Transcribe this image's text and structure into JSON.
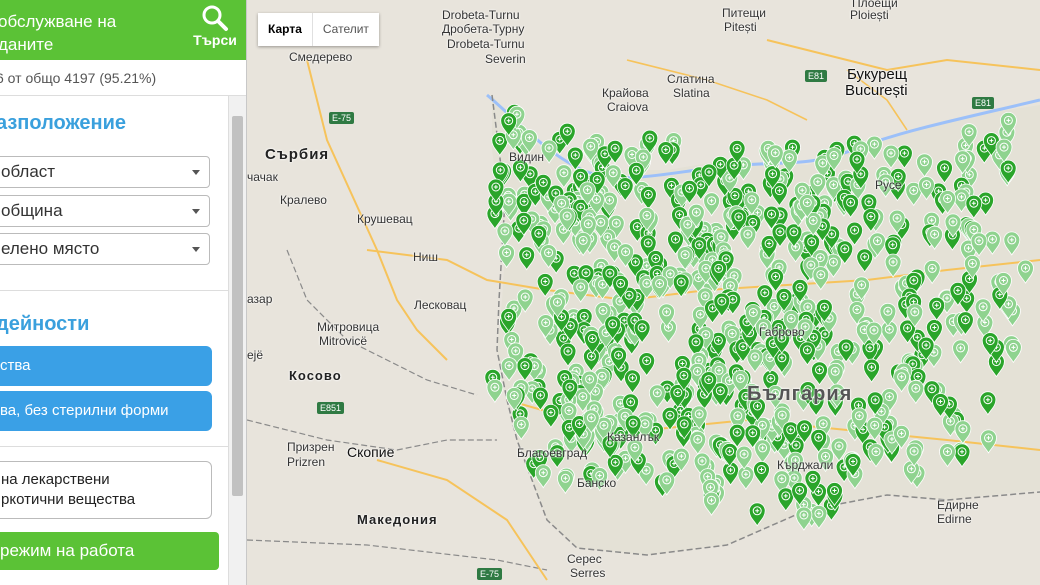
{
  "sidebar": {
    "title_line1": "обслужване на",
    "title_line2": "даните",
    "search_label": "Търси",
    "stats": "6 от общо 4197 (95.21%)",
    "location_title": "азположение",
    "selects": [
      {
        "value": " област"
      },
      {
        "value": " община"
      },
      {
        "value": "елено място"
      }
    ],
    "activities_title": "дейности",
    "activity_buttons": [
      {
        "label": "ства"
      },
      {
        "label": "ва, без стерилни форми"
      }
    ],
    "checkbox_line1": "на лекарствени",
    "checkbox_line2": "ркотични вещества",
    "hours_button": "режим на работа"
  },
  "map": {
    "type_buttons": {
      "map": "Карта",
      "satellite": "Сателит"
    },
    "labels": {
      "smederevo": "Смедерево",
      "drobeta_top": "Drobeta-Turnu",
      "drobeta_cyr": "Дробета-Турну",
      "drobeta_lat": "Drobeta-Turnu",
      "severin": "Severin",
      "severin_cyr": "Северин",
      "pitesti_cyr": "Питещи",
      "pitesti": "Pitești",
      "ploiesti_cyr": "Плоещи",
      "ploiesti": "Ploiești",
      "slatina_cyr": "Слатина",
      "slatina": "Slatina",
      "craiova_cyr": "Крайова",
      "craiova": "Craiova",
      "bucharest_cyr": "Букурещ",
      "bucharest": "București",
      "serbia": "Сърбия",
      "vidin": "Видин",
      "chachak": "чачак",
      "kraljevo": "Кралево",
      "krusevac": "Крушевац",
      "nis": "Ниш",
      "leskovac": "Лесковац",
      "novi_pazar": "азар",
      "mitrovica_cyr": "Митровица",
      "mitrovica": "Mitrovicë",
      "peje": "ejë",
      "kosovo": "Косово",
      "prizren_cyr": "Призрен",
      "prizren": "Prizren",
      "skopje": "Скопие",
      "macedonia": "Македония",
      "serres_cyr": "Серес",
      "serres": "Serres",
      "ruse": "Русе",
      "gabrovo": "Габрово",
      "bulgaria": "България",
      "kardzhali": "Кърджали",
      "edirne_cyr": "Едирне",
      "edirne": "Edirne",
      "blagoevgrad": "Благоевград",
      "bansko": "Банско",
      "kazanlak": "Казанлък"
    },
    "roads": {
      "e75_top": "E-75",
      "e81": "E81",
      "e81b": "E81",
      "e851": "E851",
      "e75_bottom": "E-75"
    },
    "colors": {
      "marker_dark": "#2aa52a",
      "marker_light": "#8fd38f",
      "accent": "#5bc236",
      "blue": "#3aa0e6"
    }
  }
}
